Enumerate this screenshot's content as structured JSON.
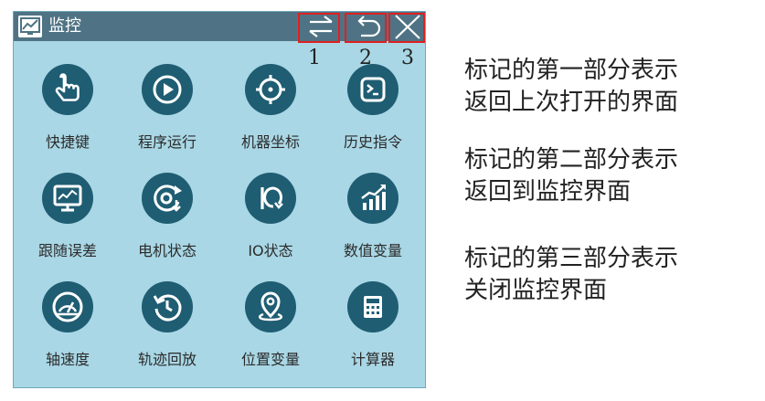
{
  "titlebar": {
    "title": "监控",
    "buttons": [
      {
        "icon": "switch-arrows-icon",
        "marker": "1"
      },
      {
        "icon": "return-icon",
        "marker": "2"
      },
      {
        "icon": "close-icon",
        "marker": "3"
      }
    ],
    "highlight_color": "#e02020"
  },
  "grid": [
    {
      "label": "快捷键",
      "icon": "hand-pointer-icon"
    },
    {
      "label": "程序运行",
      "icon": "play-icon"
    },
    {
      "label": "机器坐标",
      "icon": "crosshair-icon"
    },
    {
      "label": "历史指令",
      "icon": "terminal-icon"
    },
    {
      "label": "跟随误差",
      "icon": "monitor-icon"
    },
    {
      "label": "电机状态",
      "icon": "motor-icon"
    },
    {
      "label": "IO状态",
      "icon": "io-icon"
    },
    {
      "label": "数值变量",
      "icon": "bar-chart-icon"
    },
    {
      "label": "轴速度",
      "icon": "speedometer-icon"
    },
    {
      "label": "轨迹回放",
      "icon": "replay-icon"
    },
    {
      "label": "位置变量",
      "icon": "location-pin-icon"
    },
    {
      "label": "计算器",
      "icon": "calculator-icon"
    }
  ],
  "notes": [
    {
      "line1": "标记的第一部分表示",
      "line2": "返回上次打开的界面"
    },
    {
      "line1": "标记的第二部分表示",
      "line2": "返回到监控界面"
    },
    {
      "line1": "标记的第三部分表示",
      "line2": "关闭监控界面"
    }
  ],
  "colors": {
    "panel_bg": "#a9d7e5",
    "titlebar_bg": "#4f7384",
    "icon_circle": "#1f5d73"
  }
}
